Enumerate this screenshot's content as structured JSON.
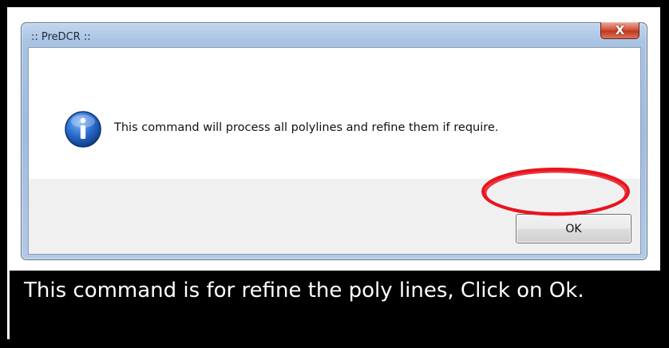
{
  "dialog": {
    "title": ":: PreDCR ::",
    "close_label": "X",
    "message": "This command will process all polylines and refine them if require.",
    "ok_label": "OK",
    "icon": "info-icon"
  },
  "caption": {
    "text": "This command is for refine the poly lines, Click on Ok."
  },
  "colors": {
    "highlight": "#e8141e",
    "caption_bg": "#000000",
    "caption_text": "#ffffff"
  }
}
